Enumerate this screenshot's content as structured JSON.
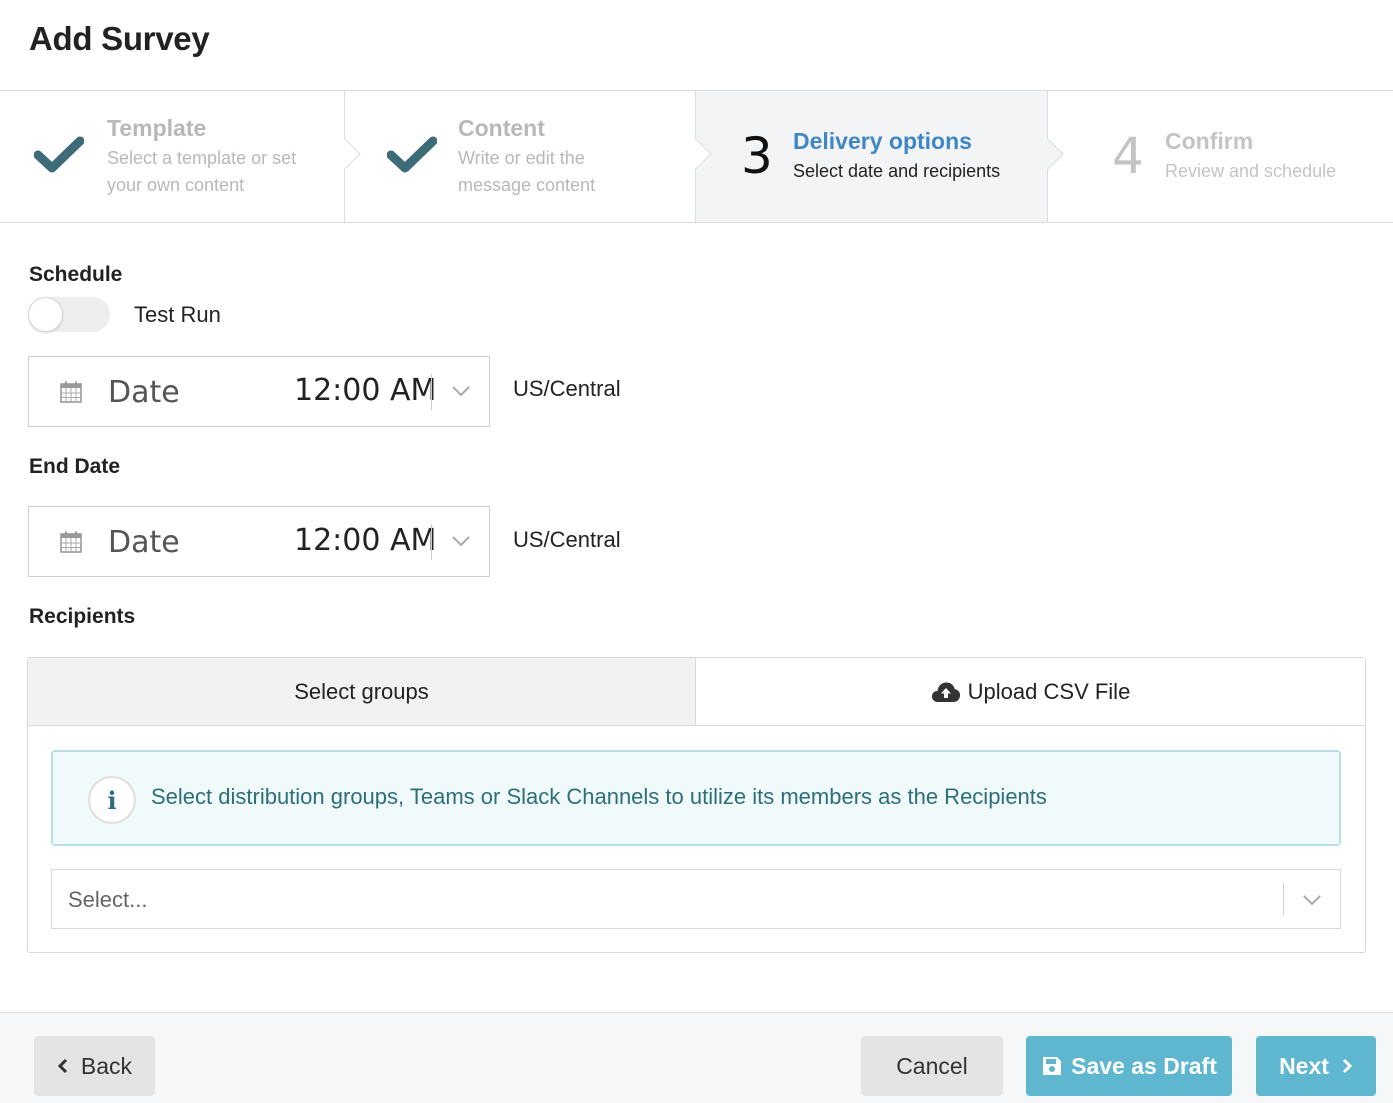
{
  "page": {
    "title": "Add Survey"
  },
  "steps": [
    {
      "state": "done",
      "title": "Template",
      "desc1": "Select a template or set",
      "desc2": "your own content",
      "icon": "check-icon"
    },
    {
      "state": "done",
      "title": "Content",
      "desc1": "Write or edit the",
      "desc2": "message content",
      "icon": "check-icon"
    },
    {
      "state": "active",
      "number": "3",
      "title": "Delivery options",
      "desc": "Select date and recipients"
    },
    {
      "state": "future",
      "number": "4",
      "title": "Confirm",
      "desc": "Review and schedule"
    }
  ],
  "schedule": {
    "label": "Schedule",
    "test_run": {
      "label": "Test Run",
      "on": false
    },
    "start": {
      "date_placeholder": "Date",
      "time": "12:00 AM",
      "timezone": "US/Central"
    }
  },
  "end_date": {
    "label": "End Date",
    "date_placeholder": "Date",
    "time": "12:00 AM",
    "timezone": "US/Central"
  },
  "recipients": {
    "label": "Recipients",
    "tabs": [
      {
        "label": "Select groups",
        "active": true
      },
      {
        "label": "Upload CSV File",
        "icon": "cloud-upload-icon",
        "active": false
      }
    ],
    "info_text": "Select distribution groups, Teams or Slack Channels to utilize its members as the Recipients",
    "select_placeholder": "Select..."
  },
  "footer": {
    "back": "Back",
    "cancel": "Cancel",
    "save_draft": "Save as Draft",
    "next": "Next"
  },
  "colors": {
    "accent": "#5eb6cf",
    "step_active_title": "#3f87c4",
    "check": "#3d6b78",
    "info_text": "#2c6e7a"
  }
}
